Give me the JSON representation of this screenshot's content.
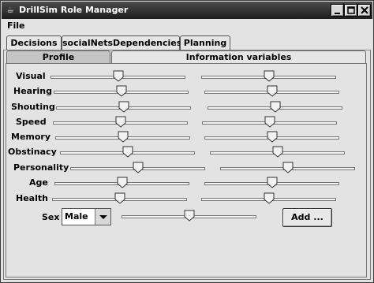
{
  "window": {
    "title": "DrillSim Role Manager"
  },
  "menu": {
    "file": "File"
  },
  "outer_tabs": [
    "Decisions",
    "socialNetsDependencies",
    "Planning"
  ],
  "inner_tabs": [
    "Profile",
    "Information variables"
  ],
  "rows": [
    {
      "label": "Visual",
      "left_value": 0.5,
      "right_value": 0.5
    },
    {
      "label": "Hearing",
      "left_value": 0.5,
      "right_value": 0.5
    },
    {
      "label": "Shouting",
      "left_value": 0.5,
      "right_value": 0.5
    },
    {
      "label": "Speed",
      "left_value": 0.5,
      "right_value": 0.5
    },
    {
      "label": "Memory",
      "left_value": 0.5,
      "right_value": 0.5
    },
    {
      "label": "Obstinacy",
      "left_value": 0.5,
      "right_value": 0.5
    },
    {
      "label": "Personality",
      "left_value": 0.5,
      "right_value": 0.5
    },
    {
      "label": "Age",
      "left_value": 0.5,
      "right_value": 0.5
    },
    {
      "label": "Health",
      "left_value": 0.5,
      "right_value": 0.5
    }
  ],
  "sex": {
    "label": "Sex",
    "selected": "Male",
    "slider_value": 0.5
  },
  "add_button": "Add ..."
}
